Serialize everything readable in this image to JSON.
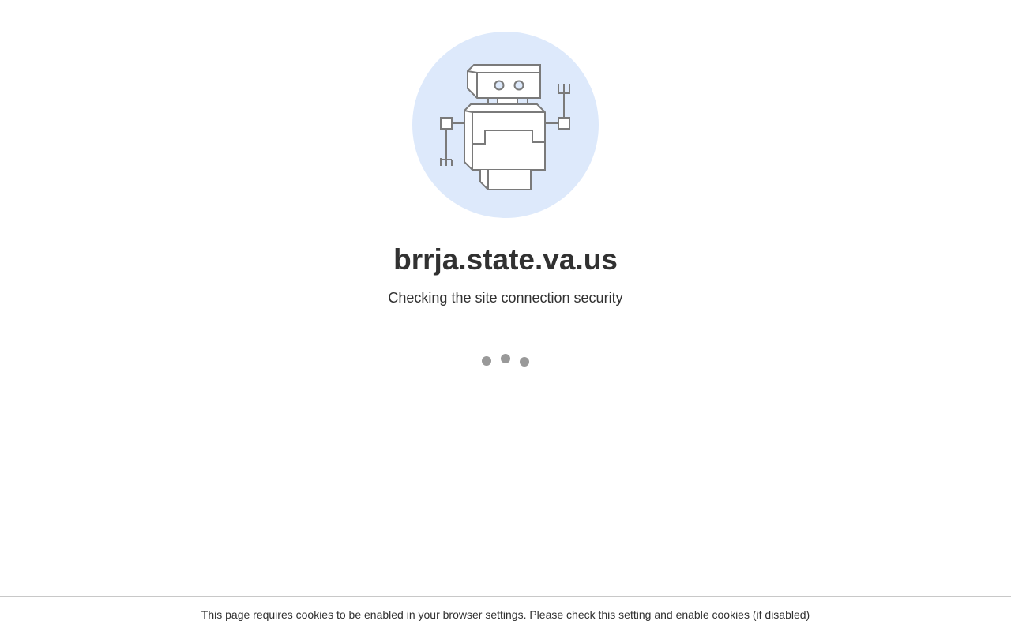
{
  "page": {
    "domain_title": "brrja.state.va.us",
    "subtitle": "Checking the site connection security",
    "footer_notice": "This page requires cookies to be enabled in your browser settings. Please check this setting and enable cookies (if disabled)"
  },
  "illustration": {
    "icon": "robot-icon",
    "circle_color": "#dde9fb",
    "line_color": "#7a7a7a"
  },
  "loader": {
    "icon": "loading-dots",
    "dot_color": "#999999"
  }
}
